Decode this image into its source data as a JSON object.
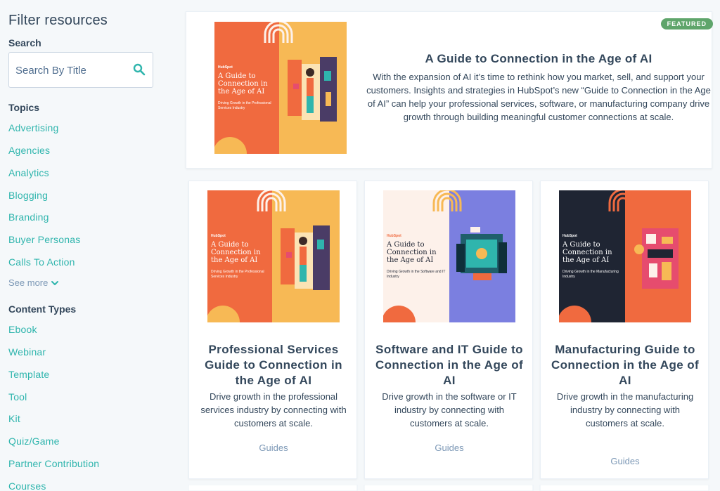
{
  "sidebar": {
    "title": "Filter resources",
    "search_label": "Search",
    "search_placeholder": "Search By Title",
    "topics_heading": "Topics",
    "topics": [
      "Advertising",
      "Agencies",
      "Analytics",
      "Blogging",
      "Branding",
      "Buyer Personas",
      "Calls To Action"
    ],
    "see_more": "See more",
    "content_types_heading": "Content Types",
    "content_types": [
      "Ebook",
      "Webinar",
      "Template",
      "Tool",
      "Kit",
      "Quiz/Game",
      "Partner Contribution",
      "Courses"
    ]
  },
  "featured": {
    "badge": "FEATURED",
    "title": "A Guide to Connection in the Age of AI",
    "description": "With the expansion of AI it’s time to rethink how you market, sell, and support your customers. Insights and strategies in HubSpot’s new “Guide to Connection in the Age of AI” can help your professional services, software, or manufacturing company drive growth through building meaningful customer connections at scale.",
    "cover": {
      "brand": "HubSpot",
      "heading": "A Guide to Connection in the Age of AI",
      "subtitle": "Driving Growth in the Professional Services Industry"
    }
  },
  "cards": [
    {
      "title": "Professional Services Guide to Connection in the Age of AI",
      "description": "Drive growth in the professional services industry by connecting with customers at scale.",
      "tag": "Guides",
      "cover": {
        "brand": "HubSpot",
        "heading": "A Guide to Connection in the Age of AI",
        "subtitle": "Driving Growth in the Professional Services Industry"
      }
    },
    {
      "title": "Software and IT Guide to Connection in the Age of AI",
      "description": "Drive growth in the software or IT industry by connecting with customers at scale.",
      "tag": "Guides",
      "cover": {
        "brand": "HubSpot",
        "heading": "A Guide to Connection in the Age of AI",
        "subtitle": "Driving Growth in the Software and IT Industry"
      }
    },
    {
      "title": "Manufacturing Guide to Connection in the Age of AI",
      "description": "Drive growth in the manufacturing industry by connecting with customers at scale.",
      "tag": "Guides",
      "cover": {
        "brand": "HubSpot",
        "heading": "A Guide to Connection in the Age of AI",
        "subtitle": "Driving Growth in the Manufacturing Industry"
      }
    }
  ],
  "colors": {
    "link": "#2fb5ad",
    "heading": "#33475b",
    "muted": "#7c98b6",
    "badge": "#5fa56b",
    "orange": "#f06a3f",
    "yellow": "#f7b955",
    "purple": "#7b7fe0",
    "navy": "#1f2533",
    "cream": "#fdf1ea"
  }
}
